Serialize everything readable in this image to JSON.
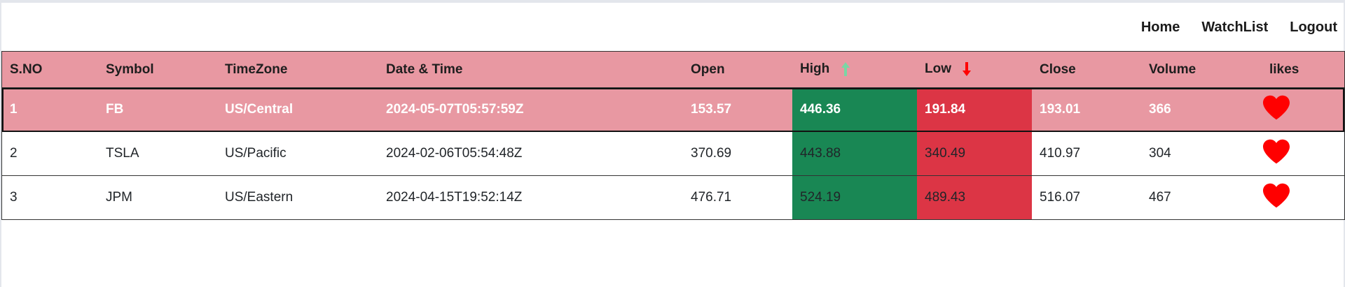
{
  "nav": {
    "items": [
      "Home",
      "WatchList",
      "Logout"
    ]
  },
  "table": {
    "headers": [
      "S.NO",
      "Symbol",
      "TimeZone",
      "Date & Time",
      "Open",
      "High",
      "Low",
      "Close",
      "Volume",
      "likes"
    ],
    "rows": [
      {
        "sno": "1",
        "symbol": "FB",
        "timezone": "US/Central",
        "datetime": "2024-05-07T05:57:59Z",
        "open": "153.57",
        "high": "446.36",
        "low": "191.84",
        "close": "193.01",
        "volume": "366"
      },
      {
        "sno": "2",
        "symbol": "TSLA",
        "timezone": "US/Pacific",
        "datetime": "2024-02-06T05:54:48Z",
        "open": "370.69",
        "high": "443.88",
        "low": "340.49",
        "close": "410.97",
        "volume": "304"
      },
      {
        "sno": "3",
        "symbol": "JPM",
        "timezone": "US/Eastern",
        "datetime": "2024-04-15T19:52:14Z",
        "open": "476.71",
        "high": "524.19",
        "low": "489.43",
        "close": "516.07",
        "volume": "467"
      }
    ]
  },
  "colors": {
    "header_bg": "#e898a2",
    "high_bg": "#198754",
    "low_bg": "#dc3545",
    "heart": "#ff0000",
    "arrow_up": "#7ad6a4",
    "arrow_down": "#ff0000"
  },
  "icons": {
    "high": "arrow-up-icon",
    "low": "arrow-down-icon",
    "like": "heart-icon"
  }
}
